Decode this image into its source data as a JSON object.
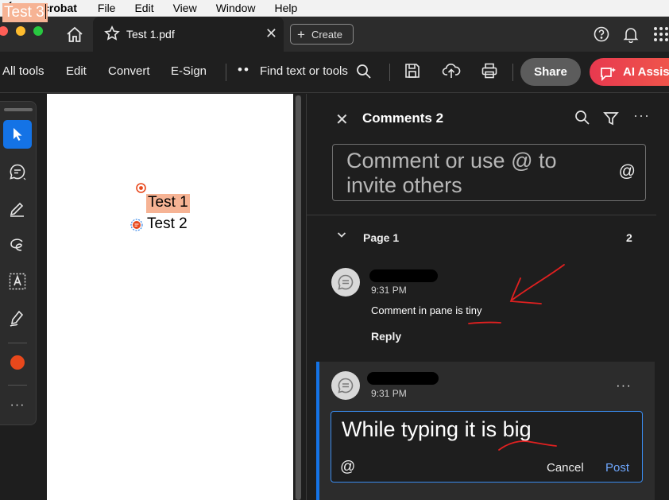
{
  "menubar": {
    "app": "Acrobat",
    "items": [
      "File",
      "Edit",
      "View",
      "Window",
      "Help"
    ]
  },
  "tabbar": {
    "tab_title": "Test 1.pdf",
    "create_label": "Create"
  },
  "toolbar": {
    "all_tools": "All tools",
    "edit": "Edit",
    "convert": "Convert",
    "esign": "E-Sign",
    "find": "Find text or tools",
    "share": "Share",
    "ai_assistant": "AI Assist"
  },
  "document": {
    "line1": "Test 1",
    "line2": "Test 2",
    "line3": "Test 3"
  },
  "panel": {
    "title": "Comments 2",
    "input_placeholder": "Comment or use @ to invite others",
    "at_symbol": "@",
    "page_label": "Page 1",
    "page_count": "2",
    "comments": [
      {
        "time": "9:31 PM",
        "text": "Comment in pane is tiny",
        "reply_label": "Reply"
      },
      {
        "time": "9:31 PM",
        "draft_text": "While typing it is big",
        "cancel_label": "Cancel",
        "post_label": "Post"
      }
    ]
  },
  "colors": {
    "accent": "#1473e6",
    "highlight": "#f6b394",
    "annotation": "#e02020",
    "ai_button": "#e8394f"
  }
}
